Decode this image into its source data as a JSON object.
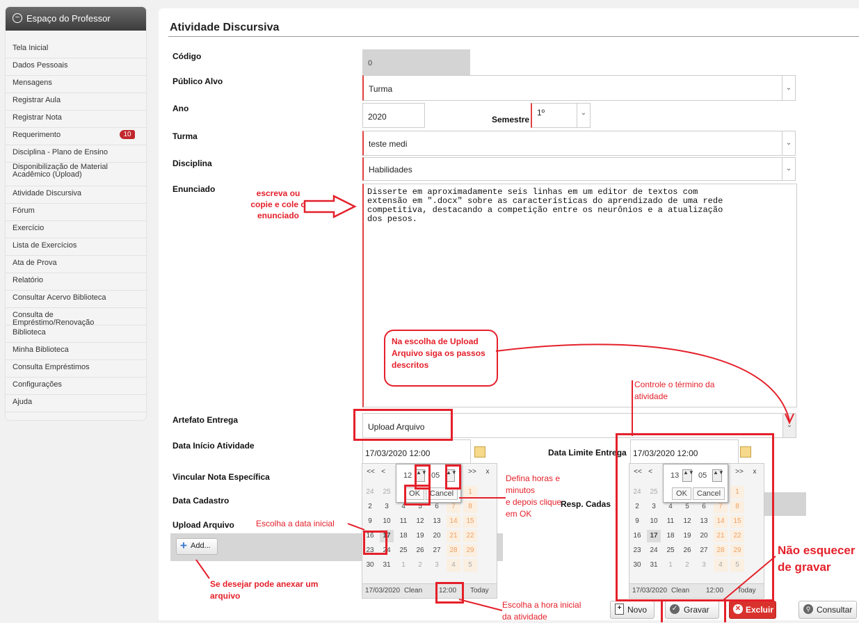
{
  "sidebar": {
    "title": "Espaço do Professor",
    "items": [
      {
        "label": "Tela Inicial"
      },
      {
        "label": "Dados Pessoais"
      },
      {
        "label": "Mensagens"
      },
      {
        "label": "Registrar Aula"
      },
      {
        "label": "Registrar Nota"
      },
      {
        "label": "Requerimento",
        "badge": "10"
      },
      {
        "label": "Disciplina - Plano de Ensino"
      },
      {
        "label": "Disponibilização de Material Acadêmico (Upload)"
      },
      {
        "label": "Atividade Discursiva"
      },
      {
        "label": "Fórum"
      },
      {
        "label": "Exercício"
      },
      {
        "label": "Lista de Exercícios"
      },
      {
        "label": "Ata de Prova"
      },
      {
        "label": "Relatório"
      },
      {
        "label": "Consultar Acervo Biblioteca"
      },
      {
        "label": "Consulta de Empréstimo/Renovação"
      },
      {
        "label": "Biblioteca"
      },
      {
        "label": "Minha Biblioteca"
      },
      {
        "label": "Consulta Empréstimos"
      },
      {
        "label": "Configurações"
      },
      {
        "label": "Ajuda"
      }
    ]
  },
  "form": {
    "title": "Atividade Discursiva",
    "codigo_label": "Código",
    "codigo_value": "0",
    "publico_label": "Público Alvo",
    "publico_value": "Turma",
    "ano_label": "Ano",
    "ano_value": "2020",
    "semestre_label": "Semestre",
    "semestre_value": "1º",
    "turma_label": "Turma",
    "turma_value": "teste medi",
    "disciplina_label": "Disciplina",
    "disciplina_value": "Habilidades",
    "enunciado_label": "Enunciado",
    "enunciado_value": "Disserte em aproximadamente seis linhas em um editor de textos com\nextensão em \".docx\" sobre as características do aprendizado de uma rede\ncompetitiva, destacando a competição entre os neurônios e a atualização\ndos pesos.",
    "artefato_label": "Artefato Entrega",
    "artefato_value": "Upload Arquivo",
    "data_inicio_label": "Data Início Atividade",
    "data_inicio_value": "17/03/2020 12:00",
    "data_limite_label": "Data Limite Entrega",
    "data_limite_value": "17/03/2020 12:00",
    "vincular_label": "Vincular Nota Específica",
    "data_cadastro_label": "Data Cadastro",
    "resp_label": "Resp. Cadas",
    "upload_label": "Upload Arquivo",
    "add_label": "Add..."
  },
  "calendar_left": {
    "nav": [
      "<<",
      "<",
      ">>",
      "x"
    ],
    "hour": "12",
    "minute": "05",
    "ok": "OK",
    "cancel": "Cancel",
    "rows": [
      [
        "24",
        "25",
        "26",
        "27",
        "28",
        "29",
        "1"
      ],
      [
        "2",
        "3",
        "4",
        "5",
        "6",
        "7",
        "8"
      ],
      [
        "9",
        "10",
        "11",
        "12",
        "13",
        "14",
        "15"
      ],
      [
        "16",
        "17",
        "18",
        "19",
        "20",
        "21",
        "22"
      ],
      [
        "23",
        "24",
        "25",
        "26",
        "27",
        "28",
        "29"
      ],
      [
        "30",
        "31",
        "1",
        "2",
        "3",
        "4",
        "5"
      ]
    ],
    "footer_date": "17/03/2020",
    "footer_clean": "Clean",
    "footer_time": "12:00",
    "footer_today": "Today"
  },
  "calendar_right": {
    "nav": [
      "<<",
      "<",
      ">>",
      "x"
    ],
    "hour": "13",
    "minute": "05",
    "ok": "OK",
    "cancel": "Cancel",
    "rows": [
      [
        "24",
        "25",
        "26",
        "27",
        "28",
        "29",
        "1"
      ],
      [
        "2",
        "3",
        "4",
        "5",
        "6",
        "7",
        "8"
      ],
      [
        "9",
        "10",
        "11",
        "12",
        "13",
        "14",
        "15"
      ],
      [
        "16",
        "17",
        "18",
        "19",
        "20",
        "21",
        "22"
      ],
      [
        "23",
        "24",
        "25",
        "26",
        "27",
        "28",
        "29"
      ],
      [
        "30",
        "31",
        "1",
        "2",
        "3",
        "4",
        "5"
      ]
    ],
    "footer_date": "17/03/2020",
    "footer_clean": "Clean",
    "footer_time": "12:00",
    "footer_today": "Today"
  },
  "buttons": {
    "novo": "Novo",
    "gravar": "Gravar",
    "excluir": "Excluir",
    "consultar": "Consultar"
  },
  "annotations": {
    "enunciado": "escreva ou\ncopie e cole o\nenunciado",
    "upload_note": "Na escolha de Upload\nArquivo siga os passos\ndescritos",
    "termino": "Controle o término da\natividade",
    "horas": "Defina horas e\nminutos\ne depois clique\nem OK",
    "data_inicial": "Escolha a data inicial",
    "anexar": "Se desejar pode anexar um\narquivo",
    "hora_inicial": "Escolha a hora inicial\nda atividade",
    "gravar": "Não esquecer\nde gravar"
  },
  "colors": {
    "annotation": "#e4202a",
    "badge": "#c0282d",
    "excluir": "#d9322d"
  }
}
